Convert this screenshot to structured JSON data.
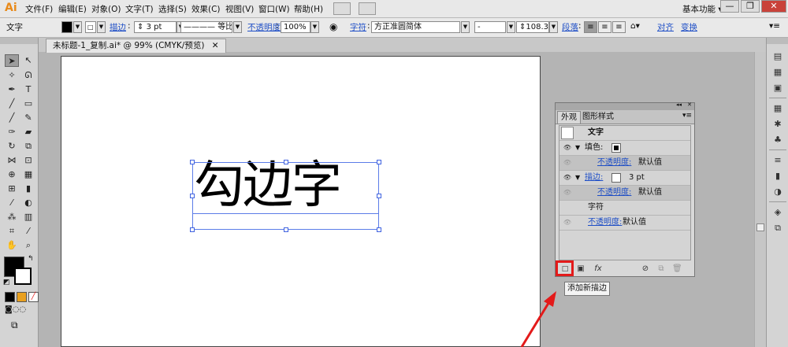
{
  "app": {
    "logo": "Ai",
    "workspace": "基本功能",
    "workspace_arrow": "▾"
  },
  "menu": [
    {
      "label": "文件(F)"
    },
    {
      "label": "编辑(E)"
    },
    {
      "label": "对象(O)"
    },
    {
      "label": "文字(T)"
    },
    {
      "label": "选择(S)"
    },
    {
      "label": "效果(C)"
    },
    {
      "label": "视图(V)"
    },
    {
      "label": "窗口(W)"
    },
    {
      "label": "帮助(H)"
    }
  ],
  "window_buttons": {
    "minimize": "—",
    "restore": "❐",
    "close": "✕"
  },
  "control_bar": {
    "tool_label": "文字",
    "stroke_label": "描边",
    "stroke_weight": "3 pt",
    "stroke_profile": "等比",
    "opacity_label": "不透明度",
    "opacity_value": "100%",
    "character_label": "字符",
    "font_name": "方正准圆简体",
    "font_style": "-",
    "font_size": "108.36",
    "paragraph_label": "段落",
    "align_label": "对齐",
    "transform_label": "变换"
  },
  "document_tab": {
    "title": "未标题-1_复制.ai* @ 99% (CMYK/预览)",
    "close": "✕"
  },
  "artboard_text": "勾边字",
  "appearance_panel": {
    "tabs": [
      "外观",
      "图形样式"
    ],
    "object_type": "文字",
    "rows": [
      {
        "label": "填色:",
        "kind": "fill"
      },
      {
        "label": "不透明度:",
        "value": "默认值",
        "kind": "opacity"
      },
      {
        "label": "描边:",
        "value": "3 pt",
        "kind": "stroke"
      },
      {
        "label": "不透明度:",
        "value": "默认值",
        "kind": "opacity"
      },
      {
        "label": "字符",
        "kind": "characters"
      },
      {
        "label": "不透明度:",
        "value": "默认值",
        "kind": "opacity"
      }
    ]
  },
  "tooltip": "添加新描边",
  "colors": {
    "highlight": "#e31a1a",
    "link": "#1e4ec6",
    "selection": "#5b7ce8",
    "fill_swatch": "#000000",
    "logo": "#e88a1a"
  }
}
